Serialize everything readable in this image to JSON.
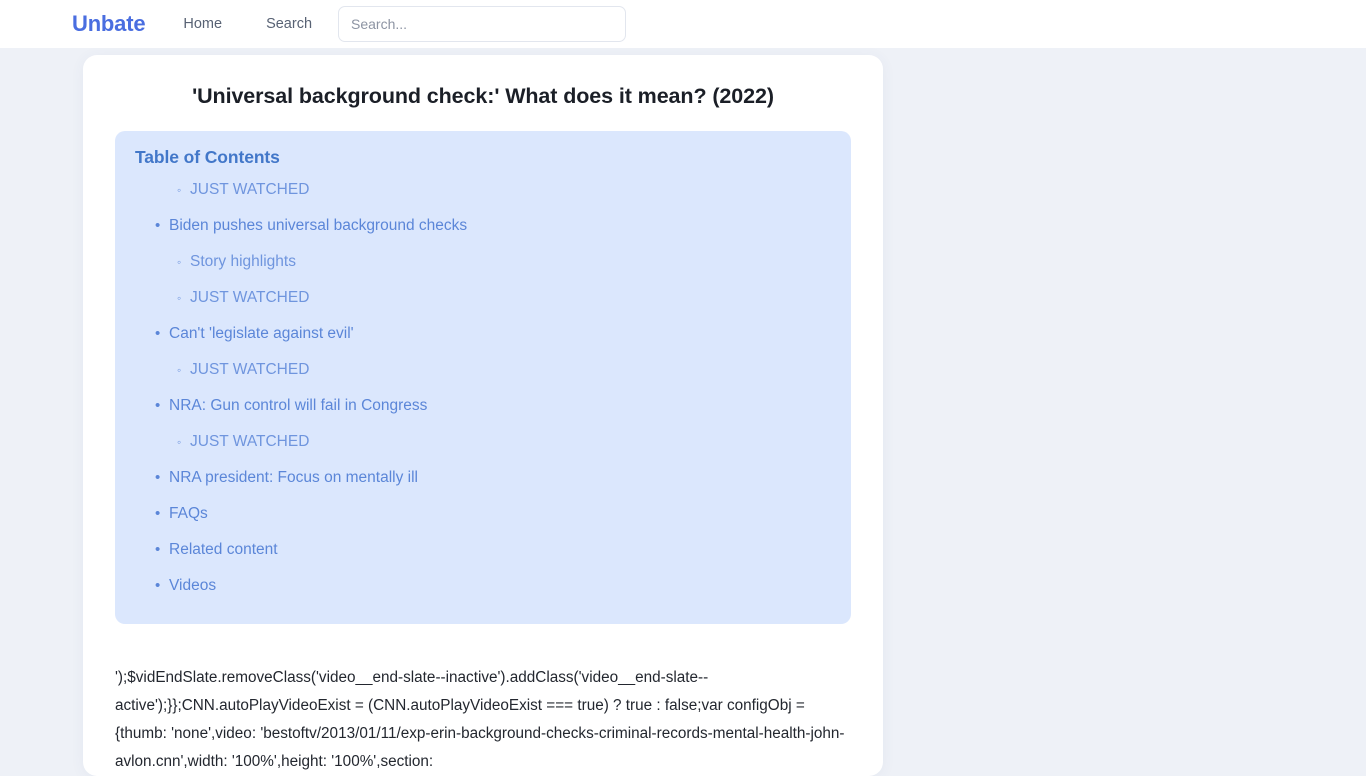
{
  "navbar": {
    "brand": "Unbate",
    "links": [
      {
        "label": "Home",
        "name": "nav-link-home"
      },
      {
        "label": "Search",
        "name": "nav-link-search"
      }
    ],
    "search": {
      "placeholder": "Search...",
      "value": ""
    }
  },
  "article": {
    "title": "'Universal background check:' What does it mean? (2022)",
    "body": "');$vidEndSlate.removeClass('video__end-slate--inactive').addClass('video__end-slate--active');}};CNN.autoPlayVideoExist = (CNN.autoPlayVideoExist === true) ? true : false;var configObj = {thumb: 'none',video: 'bestoftv/2013/01/11/exp-erin-background-checks-criminal-records-mental-health-john-avlon.cnn',width: '100%',height: '100%',section:"
  },
  "toc": {
    "title": "Table of Contents",
    "bullets": {
      "level1": "•",
      "level2": "◦"
    },
    "items": [
      {
        "label": "JUST WATCHED",
        "level": 2
      },
      {
        "label": "Biden pushes universal background checks",
        "level": 1
      },
      {
        "label": "Story highlights",
        "level": 2
      },
      {
        "label": "JUST WATCHED",
        "level": 2
      },
      {
        "label": "Can't 'legislate against evil'",
        "level": 1
      },
      {
        "label": "JUST WATCHED",
        "level": 2
      },
      {
        "label": "NRA: Gun control will fail in Congress",
        "level": 1
      },
      {
        "label": "JUST WATCHED",
        "level": 2
      },
      {
        "label": "NRA president: Focus on mentally ill",
        "level": 1
      },
      {
        "label": "FAQs",
        "level": 1
      },
      {
        "label": "Related content",
        "level": 1
      },
      {
        "label": "Videos",
        "level": 1
      }
    ]
  },
  "colors": {
    "brand": "#4a6ee0",
    "toc_background": "#dbe7fd",
    "toc_title": "#4277c9",
    "toc_link_level1": "#5b86d8",
    "toc_link_level2": "#6f95de",
    "page_background": "#eef1f7"
  }
}
